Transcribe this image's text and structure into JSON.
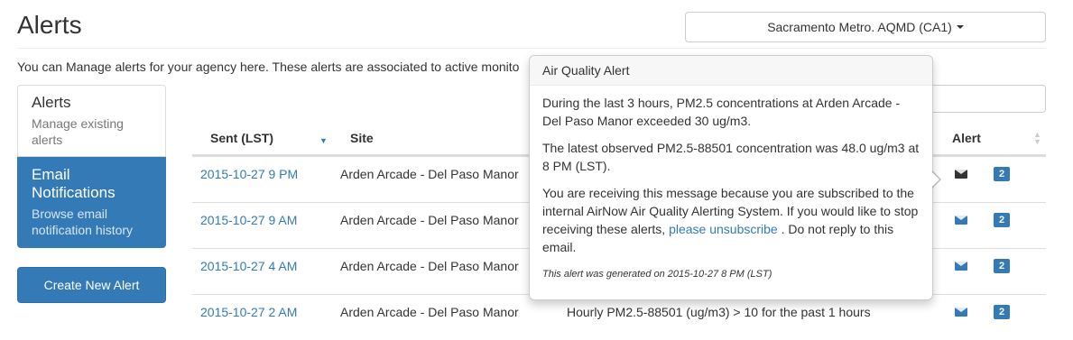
{
  "header": {
    "title": "Alerts",
    "agency_select": "Sacramento Metro. AQMD (CA1)"
  },
  "intro": "You can Manage alerts for your agency here. These alerts are associated to active monito",
  "nav": {
    "items": [
      {
        "title": "Alerts",
        "subtitle": "Manage existing alerts"
      },
      {
        "title": "Email Notifications",
        "subtitle": "Browse email notification history"
      }
    ],
    "create_button": "Create New Alert"
  },
  "table": {
    "columns": {
      "sent": "Sent (LST)",
      "site": "Site",
      "alert": "Alert"
    },
    "rows": [
      {
        "sent": "2015-10-27 9 PM",
        "site": "Arden Arcade - Del Paso Manor",
        "description": "",
        "badge": "2"
      },
      {
        "sent": "2015-10-27 9 AM",
        "site": "Arden Arcade - Del Paso Manor",
        "description": "",
        "badge": "2"
      },
      {
        "sent": "2015-10-27 4 AM",
        "site": "Arden Arcade - Del Paso Manor",
        "description": "",
        "badge": "2"
      },
      {
        "sent": "2015-10-27 2 AM",
        "site": "Arden Arcade - Del Paso Manor",
        "description": "Hourly PM2.5-88501 (ug/m3) > 10 for the past 1 hours",
        "badge": "2"
      }
    ]
  },
  "popover": {
    "title": "Air Quality Alert",
    "p1": "During the last 3 hours, PM2.5 concentrations at Arden Arcade - Del Paso Manor exceeded 30 ug/m3.",
    "p2": "The latest observed PM2.5-88501 concentration was 48.0 ug/m3 at 8 PM (LST).",
    "p3_before": "You are receiving this message because you are subscribed to the internal AirNow Air Quality Alerting System. If you would like to stop receiving these alerts,",
    "p3_link": "please unsubscribe",
    "p3_after": ". Do not reply to this email.",
    "note": "This alert was generated on 2015-10-27 8 PM (LST)"
  },
  "colors": {
    "primary": "#337ab7",
    "border": "#dddddd",
    "text": "#333333"
  },
  "icons": {
    "mail": "envelope-icon",
    "sort_active": "triangle-down-icon",
    "sort": "sort-icon",
    "caret": "caret-down-icon"
  }
}
